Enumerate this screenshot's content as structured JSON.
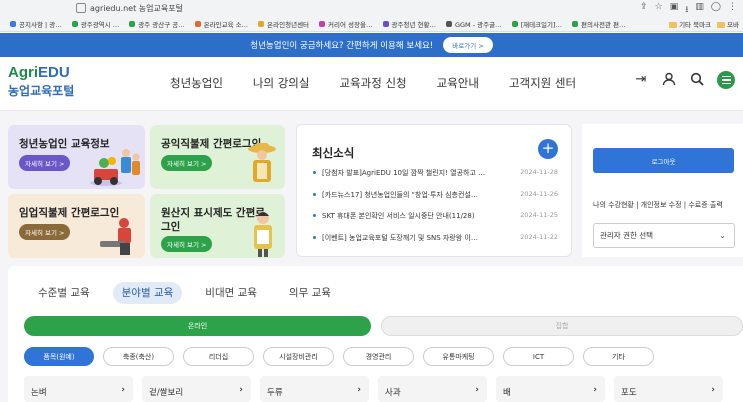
{
  "browser": {
    "url": "agriedu.net 농업교육포털",
    "bookmarks": [
      {
        "label": "공지사항 | 광…",
        "color": "#3a7bd5"
      },
      {
        "label": "광주광역시 …",
        "color": "#2da24a"
      },
      {
        "label": "광주 광산구 공…",
        "color": "#2da24a"
      },
      {
        "label": "온라인교육 소…",
        "color": "#e06c2b"
      },
      {
        "label": "온라인청년센터",
        "color": "#e0a92b"
      },
      {
        "label": "커리어 성장을…",
        "color": "#c23fb3"
      },
      {
        "label": "광주청년 현황…",
        "color": "#6a4fc2"
      },
      {
        "label": "GGM - 광주글…",
        "color": "#555555"
      },
      {
        "label": "[재테크일기]…",
        "color": "#2da24a"
      },
      {
        "label": "편의사전관 편…",
        "color": "#2da24a"
      }
    ],
    "bookmarks_right": [
      "기타 북마크",
      "모바"
    ]
  },
  "banner": {
    "text": "청년농업인이 궁금하세요? 간편하게 이용해 보세요!",
    "button": "바로가기 >"
  },
  "header": {
    "logo_top_a": "Agri",
    "logo_top_b": "EDU",
    "logo_bottom": "농업교육포털",
    "nav": [
      "청년농업인",
      "나의 강의실",
      "교육과정 신청",
      "교육안내",
      "고객지원 센터"
    ],
    "icons": [
      "login-icon",
      "user-icon",
      "search-icon",
      "menu-icon"
    ]
  },
  "cards": [
    {
      "title": "청년농업인 교육정보",
      "more": "자세히 보기 >"
    },
    {
      "title": "공익직불제 간편로그인",
      "more": "자세히 보기 >"
    },
    {
      "title": "임업직불제 간편로그인",
      "more": "자세히 보기 >"
    },
    {
      "title": "원산지 표시제도 간편로그인",
      "more": "자세히 보기 >"
    }
  ],
  "news": {
    "title": "최신소식",
    "items": [
      {
        "text": "[당첨자 발표]AgriEDU 10일 깜짝 챌린지! 열공하고 …",
        "date": "2024-11-28"
      },
      {
        "text": "[카드뉴스17] 청년농업인들의 \"창업·투자 심층컨설…",
        "date": "2024-11-26"
      },
      {
        "text": "SKT 휴대폰 본인확인 서비스 일시중단 안내(11/28)",
        "date": "2024-11-25"
      },
      {
        "text": "[이벤트] 농업교육포털 도장깨기 및 SNS 자랑왕 이…",
        "date": "2024-11-22"
      }
    ]
  },
  "account": {
    "logout": "로그아웃",
    "links": "나의 수강현황 | 개인정보 수정 | 수료증 출력",
    "select": "관리자 권한 선택"
  },
  "courses": {
    "tabs": [
      "수준별 교육",
      "분야별 교육",
      "비대면 교육",
      "의무 교육"
    ],
    "active_tab": 1,
    "online": "온라인",
    "offline": "집합",
    "pills": [
      "품목(원예)",
      "축종(축산)",
      "리더십",
      "시설장비관리",
      "경영관리",
      "유통마케팅",
      "ICT",
      "기타"
    ],
    "categories": [
      "논벼",
      "겉/쌀보리",
      "두류",
      "사과",
      "배",
      "포도"
    ]
  },
  "colors": {
    "accent": "#2f74d6",
    "green": "#2da24a"
  }
}
